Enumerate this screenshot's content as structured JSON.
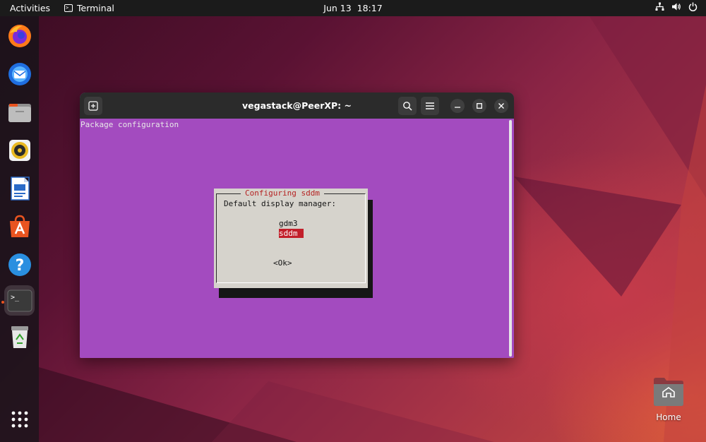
{
  "colors": {
    "topbar_bg": "#1b1b1b",
    "terminal_bg": "#a34bbf",
    "dialog_bg": "#d6d3cc",
    "dialog_title": "#b52222",
    "selection_bg": "#c21f2a",
    "accent_running": "#e95420"
  },
  "topbar": {
    "activities": "Activities",
    "app_name": "Terminal",
    "clock": "Jun 13  18:17",
    "tray_icons": [
      "network-icon",
      "volume-icon",
      "power-icon"
    ]
  },
  "dock": {
    "items": [
      {
        "name": "firefox-icon"
      },
      {
        "name": "thunderbird-icon"
      },
      {
        "name": "files-icon"
      },
      {
        "name": "rhythmbox-icon"
      },
      {
        "name": "libreoffice-writer-icon"
      },
      {
        "name": "app-center-icon"
      },
      {
        "name": "help-icon"
      },
      {
        "name": "terminal-icon",
        "active": true
      },
      {
        "name": "trash-icon"
      }
    ],
    "show_apps": "show-apps-grid-icon"
  },
  "window": {
    "title": "vegastack@PeerXP: ~",
    "buttons": [
      "new-tab-icon",
      "search-icon",
      "hamburger-menu-icon",
      "minimize-icon",
      "maximize-icon",
      "close-icon"
    ]
  },
  "terminal": {
    "header": "Package configuration",
    "dialog": {
      "title": "Configuring sddm",
      "prompt": "Default display manager:",
      "options": [
        "gdm3",
        "sddm"
      ],
      "selected": "sddm",
      "ok": "<Ok>"
    }
  },
  "desktop": {
    "home_label": "Home"
  }
}
